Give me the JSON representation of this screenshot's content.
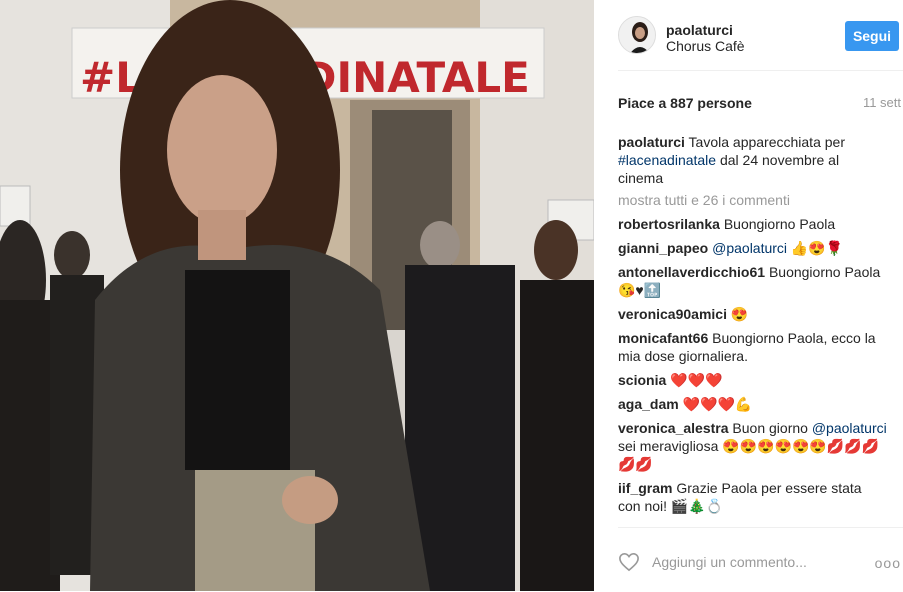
{
  "post": {
    "photo": {
      "banner_text": "#LACENADINATALE",
      "description": "woman in dark jacket at cinema event"
    },
    "header": {
      "username": "paolaturci",
      "location": "Chorus Cafè",
      "follow_label": "Segui"
    },
    "likes_text": "Piace a 887 persone",
    "date_text": "11 sett",
    "comments": [
      {
        "user": "paolaturci",
        "parts": [
          {
            "text": "Tavola apparecchiata per "
          },
          {
            "text": "#lacenadinatale",
            "link": true
          },
          {
            "text": " dal 24 novembre al cinema"
          }
        ]
      }
    ],
    "more_comments": "mostra tutti e 26 i commenti",
    "thread": [
      {
        "user": "robertosrilanka",
        "parts": [
          {
            "text": "Buongiorno Paola"
          }
        ]
      },
      {
        "user": "gianni_papeo",
        "parts": [
          {
            "text": "@paolaturci",
            "link": true
          },
          {
            "text": " 👍😍🌹"
          }
        ]
      },
      {
        "user": "antonellaverdicchio61",
        "parts": [
          {
            "text": "Buongiorno Paola 😘♥🔝"
          }
        ]
      },
      {
        "user": "veronica90amici",
        "parts": [
          {
            "text": "😍"
          }
        ]
      },
      {
        "user": "monicafant66",
        "parts": [
          {
            "text": "Buongiorno Paola, ecco la mia dose giornaliera."
          }
        ]
      },
      {
        "user": "scionia",
        "parts": [
          {
            "text": "❤️❤️❤️"
          }
        ]
      },
      {
        "user": "aga_dam",
        "parts": [
          {
            "text": "❤️❤️❤️💪"
          }
        ]
      },
      {
        "user": "veronica_alestra",
        "parts": [
          {
            "text": "Buon giorno "
          },
          {
            "text": "@paolaturci",
            "link": true
          },
          {
            "text": " sei meravigliosa 😍😍😍😍😍😍💋💋💋💋💋"
          }
        ]
      },
      {
        "user": "iif_gram",
        "parts": [
          {
            "text": "Grazie Paola per essere stata con noi! 🎬🎄💍"
          }
        ]
      }
    ],
    "add_comment_placeholder": "Aggiungi un commento...",
    "more_options": "ooo"
  },
  "colors": {
    "accent": "#3897f0",
    "link": "#003569",
    "muted": "#999999",
    "text": "#262626"
  },
  "icons": {
    "like": "heart-outline-icon",
    "options": "more-options-icon"
  }
}
